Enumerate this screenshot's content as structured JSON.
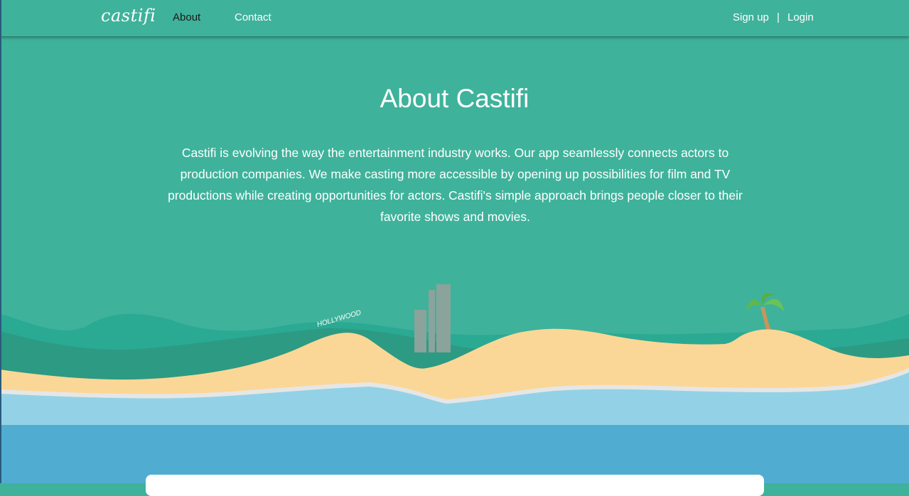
{
  "nav": {
    "brand": "castifi",
    "about": "About",
    "contact": "Contact",
    "signup": "Sign up",
    "separator": "|",
    "login": "Login"
  },
  "hero": {
    "title": "About Castifi",
    "description": "Castifi is evolving the way the entertainment industry works. Our app seamlessly connects actors to production companies. We make casting more accessible by opening up possibilities for film and TV productions while creating opportunities for actors. Castifi's simple approach brings people closer to their favorite shows and movies."
  },
  "scene": {
    "sign_text": "HOLLYWOOD"
  },
  "colors": {
    "primary": "#3fb29b",
    "sand": "#fad796",
    "shallow_water": "#93d2e6",
    "deep_water": "#51acd2"
  }
}
